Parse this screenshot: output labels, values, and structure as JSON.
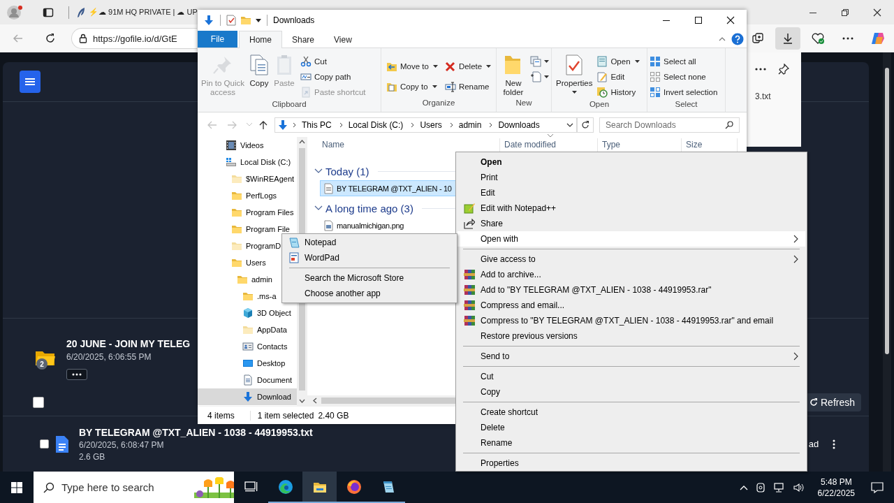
{
  "browser": {
    "tab": {
      "title": "⚡☁ 91M HQ PRIVATE | ☁ UP"
    },
    "address": {
      "url": "https://gofile.io/d/GtE"
    }
  },
  "site": {
    "folder": {
      "name": "20 JUNE - JOIN MY TELEG",
      "date": "6/20/2025, 6:06:55 PM",
      "count": "2"
    },
    "select_all": {
      "checked": false
    },
    "refresh_button": {
      "label": "Refresh"
    },
    "file": {
      "name": "BY TELEGRAM @TXT_ALIEN - 1038 - 44919953.txt",
      "date": "6/20/2025, 6:08:47 PM",
      "size": "2.6 GB",
      "checked": false
    },
    "download_button": {
      "label": "ad"
    }
  },
  "downloads_panel": {
    "filename": "3.txt"
  },
  "explorer": {
    "title": "Downloads",
    "ribbon_tabs": [
      {
        "label": "File",
        "kind": "file",
        "selected": false
      },
      {
        "label": "Home",
        "kind": "tab",
        "selected": true
      },
      {
        "label": "Share",
        "kind": "tab",
        "selected": false
      },
      {
        "label": "View",
        "kind": "tab",
        "selected": false
      }
    ],
    "ribbon_groups": [
      {
        "label": "Clipboard",
        "columns": [
          {
            "kind": "large",
            "commands": [
              {
                "kind": "pin",
                "label": "Pin to Quick access",
                "disabled": true,
                "dropdown": false
              }
            ]
          },
          {
            "kind": "large",
            "commands": [
              {
                "kind": "copy",
                "label": "Copy",
                "disabled": false,
                "dropdown": false
              }
            ]
          },
          {
            "kind": "large",
            "commands": [
              {
                "kind": "paste",
                "label": "Paste",
                "disabled": true,
                "dropdown": false
              }
            ]
          },
          {
            "kind": "stack",
            "commands": [
              {
                "kind": "cut",
                "label": "Cut",
                "disabled": false,
                "dropdown": false
              },
              {
                "kind": "copy_path",
                "label": "Copy path",
                "disabled": false,
                "dropdown": false
              },
              {
                "kind": "paste_shortcut",
                "label": "Paste shortcut",
                "disabled": true,
                "dropdown": false
              }
            ]
          }
        ]
      },
      {
        "label": "Organize",
        "columns": [
          {
            "kind": "pair",
            "commands": [
              {
                "kind": "move_to",
                "label": "Move to",
                "disabled": false,
                "dropdown": true
              },
              {
                "kind": "copy_to",
                "label": "Copy to",
                "disabled": false,
                "dropdown": true
              }
            ]
          },
          {
            "kind": "pair",
            "commands": [
              {
                "kind": "delete",
                "label": "Delete",
                "disabled": false,
                "dropdown": true
              },
              {
                "kind": "rename",
                "label": "Rename",
                "disabled": false,
                "dropdown": false
              }
            ]
          }
        ]
      },
      {
        "label": "New",
        "columns": [
          {
            "kind": "large",
            "commands": [
              {
                "kind": "new_folder",
                "label": "New folder",
                "disabled": false,
                "dropdown": false
              }
            ]
          },
          {
            "kind": "stack",
            "commands": [
              {
                "kind": "new_item",
                "disabled": false,
                "dropdown": true
              },
              {
                "kind": "easy_access",
                "disabled": false,
                "dropdown": true
              }
            ]
          }
        ]
      },
      {
        "label": "Open",
        "columns": [
          {
            "kind": "large",
            "commands": [
              {
                "kind": "properties",
                "label": "Properties",
                "disabled": false,
                "dropdown": true
              }
            ]
          },
          {
            "kind": "stack",
            "commands": [
              {
                "kind": "open",
                "label": "Open",
                "disabled": false,
                "dropdown": true
              },
              {
                "kind": "edit",
                "label": "Edit",
                "disabled": false,
                "dropdown": false
              },
              {
                "kind": "history",
                "label": "History",
                "disabled": false,
                "dropdown": false
              }
            ]
          }
        ]
      },
      {
        "label": "Select",
        "columns": [
          {
            "kind": "stack",
            "commands": [
              {
                "kind": "select_all",
                "label": "Select all",
                "disabled": false,
                "dropdown": false
              },
              {
                "kind": "select_none",
                "label": "Select none",
                "disabled": false,
                "dropdown": false
              },
              {
                "kind": "invert_selection",
                "label": "Invert selection",
                "disabled": false,
                "dropdown": false
              }
            ]
          }
        ]
      }
    ],
    "path": [
      "This PC",
      "Local Disk (C:)",
      "Users",
      "admin",
      "Downloads"
    ],
    "search": {
      "placeholder": "Search Downloads"
    },
    "nav_tree": [
      {
        "label": "Videos",
        "kind": "videos",
        "selected": false
      },
      {
        "label": "Local Disk (C:)",
        "kind": "drive",
        "selected": false,
        "children": [
          {
            "label": "$WinREAgent",
            "kind": "hidden_folder",
            "selected": false
          },
          {
            "label": "PerfLogs",
            "kind": "folder",
            "selected": false
          },
          {
            "label": "Program Files",
            "kind": "folder",
            "selected": false
          },
          {
            "label": "Program File",
            "kind": "folder",
            "selected": false
          },
          {
            "label": "ProgramD",
            "kind": "hidden_folder",
            "selected": false
          },
          {
            "label": "Users",
            "kind": "folder",
            "selected": false,
            "children": [
              {
                "label": "admin",
                "kind": "folder",
                "selected": false,
                "children": [
                  {
                    "label": ".ms-a",
                    "kind": "folder",
                    "selected": false
                  },
                  {
                    "label": "3D Object",
                    "kind": "objects",
                    "selected": false
                  },
                  {
                    "label": "AppData",
                    "kind": "hidden_folder",
                    "selected": false
                  },
                  {
                    "label": "Contacts",
                    "kind": "contacts",
                    "selected": false
                  },
                  {
                    "label": "Desktop",
                    "kind": "desktop",
                    "selected": false
                  },
                  {
                    "label": "Document",
                    "kind": "documents",
                    "selected": false
                  },
                  {
                    "label": "Download",
                    "kind": "downloads",
                    "selected": true
                  }
                ]
              }
            ]
          }
        ]
      }
    ],
    "columns": [
      "Name",
      "Date modified",
      "Type",
      "Size"
    ],
    "groups": [
      {
        "title": "Today (1)",
        "expanded": true,
        "files": [
          {
            "name": "BY TELEGRAM @TXT_ALIEN - 10",
            "kind": "text",
            "selected": true
          }
        ]
      },
      {
        "title": "A long time ago (3)",
        "expanded": true,
        "files": [
          {
            "name": "manualmichigan.png",
            "kind": "image",
            "selected": false
          }
        ]
      }
    ],
    "status": {
      "items": "4 items",
      "selection": "1 item selected",
      "size": "2.40 GB"
    }
  },
  "context_menu": {
    "items": [
      {
        "kind": "command",
        "label": "Open",
        "default": true,
        "submenu": false,
        "selected": false
      },
      {
        "kind": "command",
        "label": "Print",
        "default": false,
        "submenu": false,
        "selected": false
      },
      {
        "kind": "command",
        "label": "Edit",
        "default": false,
        "submenu": false,
        "selected": false
      },
      {
        "kind": "notepadpp",
        "label": "Edit with Notepad++",
        "default": false,
        "submenu": false,
        "selected": false
      },
      {
        "kind": "share",
        "label": "Share",
        "default": false,
        "submenu": false,
        "selected": false
      },
      {
        "kind": "command",
        "label": "Open with",
        "default": false,
        "submenu": true,
        "selected": true
      },
      {
        "kind": "separator"
      },
      {
        "kind": "command",
        "label": "Give access to",
        "default": false,
        "submenu": true,
        "selected": false
      },
      {
        "kind": "archive",
        "label": "Add to archive...",
        "default": false,
        "submenu": false,
        "selected": false
      },
      {
        "kind": "archive",
        "label": "Add to \"BY TELEGRAM @TXT_ALIEN - 1038 - 44919953.rar\"",
        "default": false,
        "submenu": false,
        "selected": false
      },
      {
        "kind": "archive",
        "label": "Compress and email...",
        "default": false,
        "submenu": false,
        "selected": false
      },
      {
        "kind": "archive",
        "label": "Compress to \"BY TELEGRAM @TXT_ALIEN - 1038 - 44919953.rar\" and email",
        "default": false,
        "submenu": false,
        "selected": false
      },
      {
        "kind": "command",
        "label": "Restore previous versions",
        "default": false,
        "submenu": false,
        "selected": false
      },
      {
        "kind": "separator"
      },
      {
        "kind": "command",
        "label": "Send to",
        "default": false,
        "submenu": true,
        "selected": false
      },
      {
        "kind": "separator"
      },
      {
        "kind": "command",
        "label": "Cut",
        "default": false,
        "submenu": false,
        "selected": false
      },
      {
        "kind": "command",
        "label": "Copy",
        "default": false,
        "submenu": false,
        "selected": false
      },
      {
        "kind": "separator"
      },
      {
        "kind": "command",
        "label": "Create shortcut",
        "default": false,
        "submenu": false,
        "selected": false
      },
      {
        "kind": "command",
        "label": "Delete",
        "default": false,
        "submenu": false,
        "selected": false
      },
      {
        "kind": "command",
        "label": "Rename",
        "default": false,
        "submenu": false,
        "selected": false
      },
      {
        "kind": "separator"
      },
      {
        "kind": "command",
        "label": "Properties",
        "default": false,
        "submenu": false,
        "selected": false
      }
    ]
  },
  "open_with_menu": {
    "items": [
      {
        "kind": "notepad",
        "label": "Notepad",
        "selected": false
      },
      {
        "kind": "wordpad",
        "label": "WordPad",
        "selected": false
      },
      {
        "kind": "separator"
      },
      {
        "kind": "command",
        "label": "Search the Microsoft Store",
        "selected": false
      },
      {
        "kind": "command",
        "label": "Choose another app",
        "selected": false
      }
    ]
  },
  "taskbar": {
    "search": {
      "placeholder": "Type here to search"
    },
    "apps": [
      {
        "kind": "task_view",
        "running": false,
        "selected": false
      },
      {
        "kind": "edge",
        "running": true,
        "selected": false
      },
      {
        "kind": "explorer",
        "running": true,
        "selected": true
      },
      {
        "kind": "firefox",
        "running": true,
        "selected": false
      },
      {
        "kind": "notepad",
        "running": true,
        "selected": false
      }
    ],
    "clock": {
      "time": "5:48 PM",
      "date": "6/22/2025"
    }
  }
}
